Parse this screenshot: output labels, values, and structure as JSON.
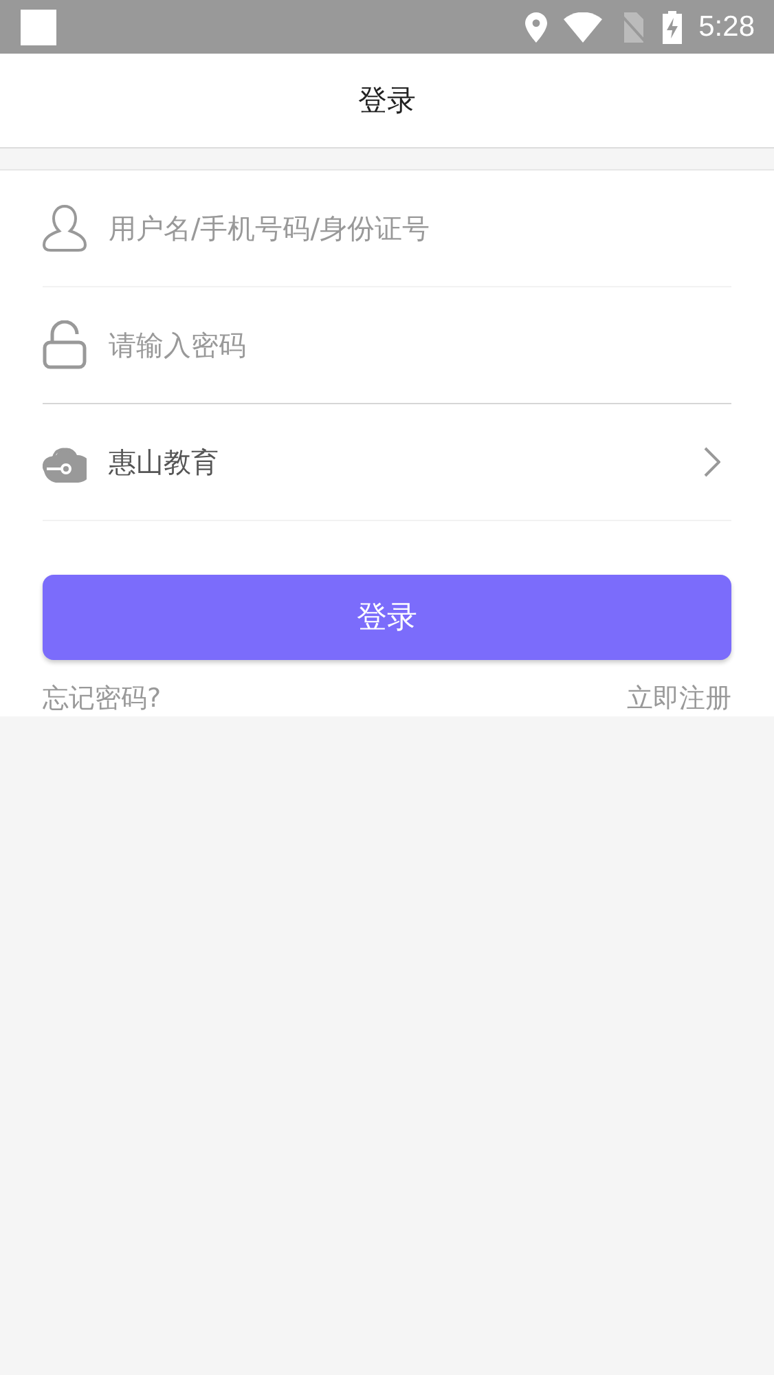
{
  "status_bar": {
    "time": "5:28"
  },
  "header": {
    "title": "登录"
  },
  "form": {
    "username": {
      "placeholder": "用户名/手机号码/身份证号"
    },
    "password": {
      "placeholder": "请输入密码"
    },
    "school": {
      "value": "惠山教育"
    },
    "submit": "登录",
    "forgot_link": "忘记密码?",
    "register_link": "立即注册"
  }
}
